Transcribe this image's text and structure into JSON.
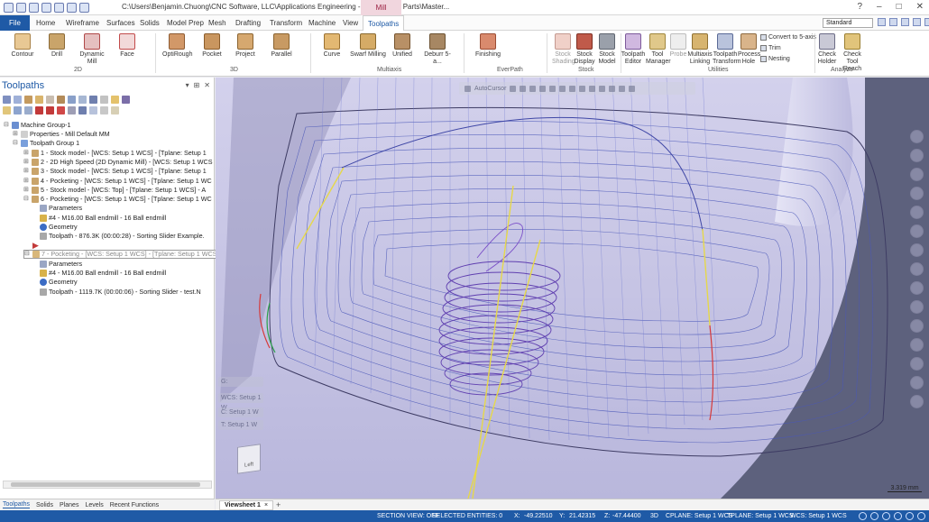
{
  "titlebar": {
    "path": "C:\\Users\\Benjamin.Chuong\\CNC Software, LLC\\Applications Engineering - Applications Parts\\Master...",
    "context_tab": "Mill"
  },
  "tabs": {
    "file": "File",
    "items": [
      "Home",
      "Wireframe",
      "Surfaces",
      "Solids",
      "Model Prep",
      "Mesh",
      "Drafting",
      "Transform",
      "Machine",
      "View",
      "Toolpaths"
    ],
    "active": "Toolpaths",
    "standard_select": "Standard"
  },
  "ribbon": {
    "g2d": {
      "label": "2D",
      "buttons": [
        "Contour",
        "Drill",
        "Dynamic Mill",
        "Face"
      ]
    },
    "g3d": {
      "label": "3D",
      "buttons": [
        "OptiRough",
        "Pocket",
        "Project",
        "Parallel"
      ]
    },
    "gmulti": {
      "label": "Multiaxis",
      "buttons": [
        "Curve",
        "Swarf Milling",
        "Unified",
        "Deburr 5-a..."
      ]
    },
    "gever": {
      "label": "EverPath",
      "buttons": [
        "Finishing"
      ]
    },
    "gstock": {
      "label": "Stock",
      "buttons": [
        "Stock Shading",
        "Stock Display",
        "Stock Model"
      ]
    },
    "gutil": {
      "label": "Utilities",
      "buttons": [
        "Toolpath Editor",
        "Tool Manager",
        "Probe",
        "Multiaxis Linking",
        "Toolpath Transform",
        "Process Hole"
      ],
      "small": [
        "Convert to 5-axis",
        "Trim",
        "Nesting"
      ]
    },
    "ganalyze": {
      "label": "Analyze",
      "buttons": [
        "Check Holder",
        "Check Tool Reach"
      ]
    }
  },
  "panel": {
    "title": "Toolpaths",
    "tree": [
      "Machine Group-1",
      "Properties - Mill Default MM",
      "Toolpath Group 1",
      "1 - Stock model - [WCS: Setup 1 WCS] - [Tplane: Setup 1",
      "2 - 2D High Speed (2D Dynamic Mill) - [WCS: Setup 1 WCS",
      "3 - Stock model - [WCS: Setup 1 WCS] - [Tplane: Setup 1",
      "4 - Pocketing - [WCS: Setup 1 WCS] - [Tplane: Setup 1 WC",
      "5 - Stock model - [WCS: Top] - [Tplane: Setup 1 WCS] - A",
      "6 - Pocketing - [WCS: Setup 1 WCS] - [Tplane: Setup 1 WC",
      "Parameters",
      "#4 - M16.00 Ball endmill - 16 Ball endmill",
      "Geometry",
      "Toolpath - 876.3K (00:00:28) - Sorting Slider Example.",
      "7 - Pocketing - [WCS: Setup 1 WCS] - [Tplane: Setup 1 WCS]",
      "Parameters",
      "#4 - M16.00 Ball endmill - 16 Ball endmill",
      "Geometry",
      "Toolpath - 1119.7K (00:00:06) - Sorting Slider - test.N"
    ],
    "bottom_tabs": [
      "Toolpaths",
      "Solids",
      "Planes",
      "Levels",
      "Recent Functions"
    ]
  },
  "viewport": {
    "autocursor": "AutoCursor",
    "overlay": [
      "G:",
      "WCS: Setup 1 W",
      "C: Setup 1 W",
      "T: Setup 1 W"
    ],
    "viewcube_label": "Left",
    "scale": "3.319 mm",
    "colors": {
      "background": "#5e627c",
      "part": "#c9c7e3",
      "toolpath": "#4a57b8",
      "feed": "#e6d84a"
    }
  },
  "sheet": {
    "tab": "Viewsheet 1",
    "close": "×",
    "add": "+"
  },
  "status": {
    "section_view": "SECTION VIEW: OFF",
    "selected": "SELECTED ENTITIES: 0",
    "x_label": "X:",
    "x": "-49.22510",
    "y_label": "Y:",
    "y": "21.42315",
    "z_label": "Z:",
    "z": "-47.44400",
    "mode": "3D",
    "cplane": "CPLANE: Setup 1 WCS",
    "tplane": "TPLANE: Setup 1 WCS",
    "wcs": "WCS: Setup 1 WCS"
  }
}
